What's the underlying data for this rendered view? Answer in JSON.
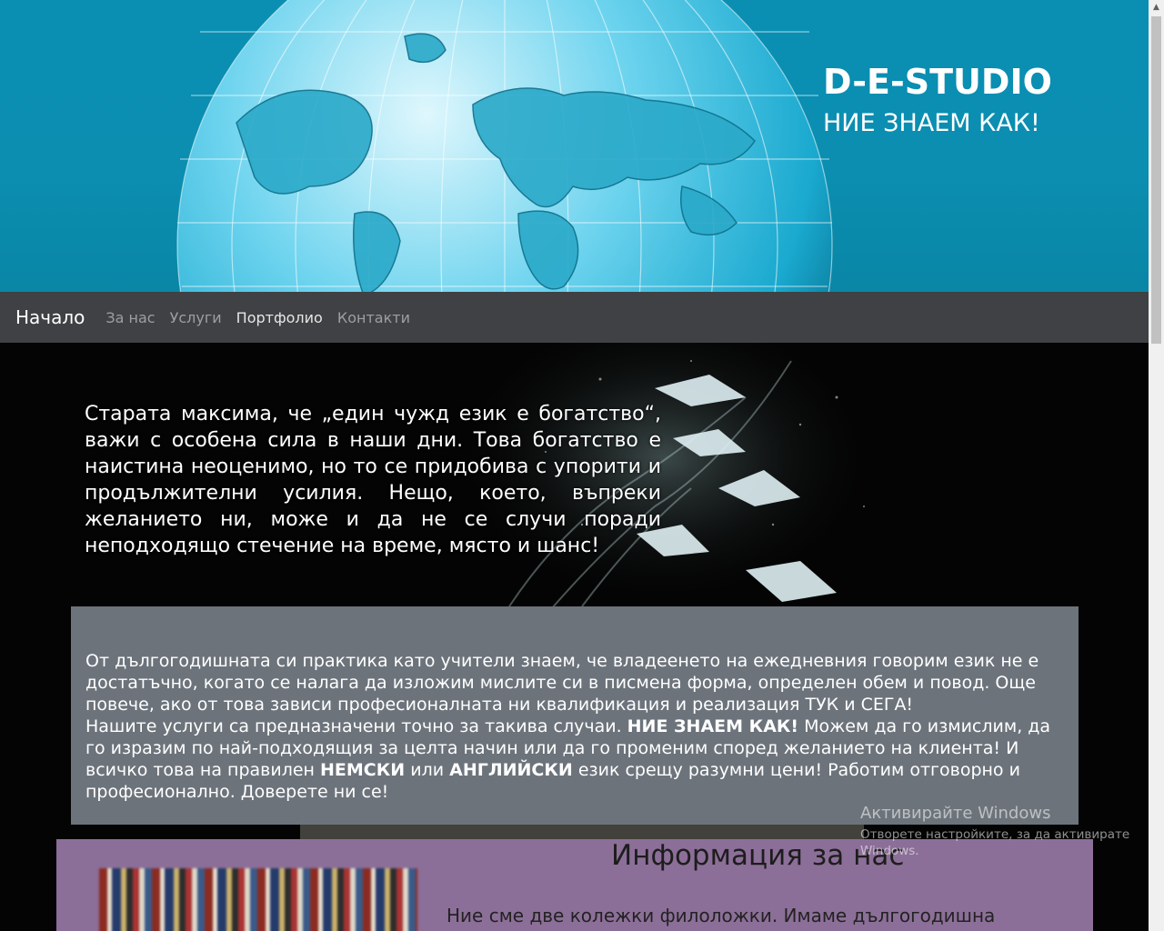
{
  "header": {
    "brand_title": "D-E-STUDIO",
    "brand_subtitle": "НИЕ ЗНАЕМ КАК!"
  },
  "nav": {
    "brand": "Начало",
    "links": [
      {
        "label": "За нас"
      },
      {
        "label": "Услуги"
      },
      {
        "label": "Портфолио"
      },
      {
        "label": "Контакти"
      }
    ]
  },
  "hero": {
    "quote": "Старата максима, че „един чужд език е богатство“, важи с особена сила в наши дни. Това богатство е наистина неоценимо, но то се придобива с упорити и продължителни усилия. Нещо, което, въпреки желанието ни, може и да не се случи поради неподходящо стечение на време, място и шанс!"
  },
  "panel": {
    "p1": "От дългогодишната си практика като учители знаем, че владеенето на ежедневния говорим език не е достатъчно, когато се налага да изложим мислите си в писмена форма, определен обем и повод. Още повече, ако от това зависи професионалната ни квалификация и реализация ТУК и СЕГА!",
    "p2_a": "Нашите услуги са предназначени точно за такива случаи. ",
    "p2_b": "НИЕ ЗНАЕМ КАК!",
    "p2_c": " Можем да го измислим, да го изразим по най-подходящия за целта начин или да го променим според желанието на клиента! И всичко това на правилен ",
    "p2_d": "НЕМСКИ",
    "p2_e": " или ",
    "p2_f": "АНГЛИЙСКИ",
    "p2_g": " език срещу разумни цени! Работим отговорно и професионално. Доверете ни се!"
  },
  "info": {
    "title": "Информация за нас",
    "text": "Ние сме две колежки филоложки. Имаме дългогодишна"
  },
  "watermark": {
    "line1": "Активирайте Windows",
    "line2": "Отворете настройките, за да активирате Windows."
  },
  "colors": {
    "header_bg": "#0b8eb0",
    "nav_bg": "#3f4144",
    "panel_bg": "#6c737b",
    "info_bg": "#8c6f98"
  }
}
